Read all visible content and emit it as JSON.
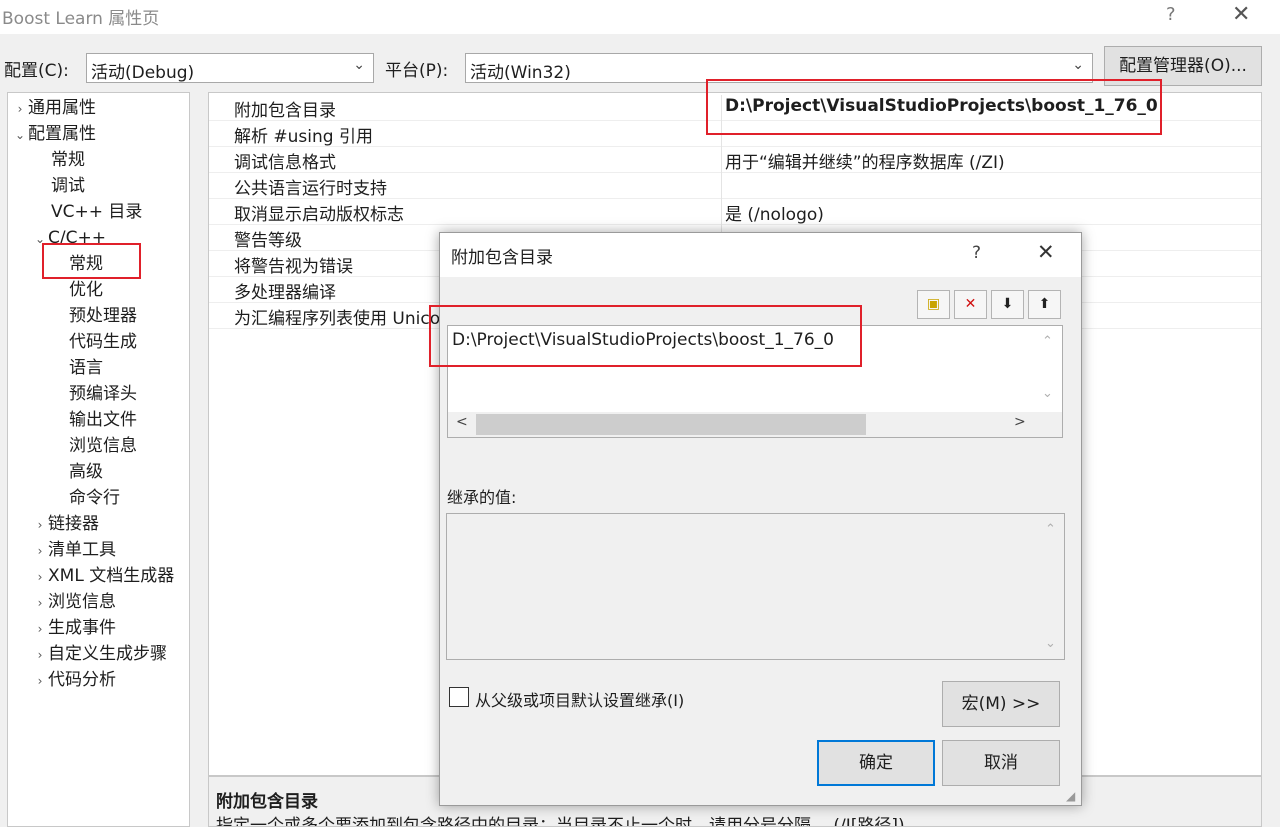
{
  "window": {
    "title": "Boost Learn 属性页",
    "help_glyph": "?",
    "close_glyph": "✕"
  },
  "config_row": {
    "config_label": "配置(C):",
    "config_value": "活动(Debug)",
    "platform_label": "平台(P):",
    "platform_value": "活动(Win32)",
    "manager_button": "配置管理器(O)..."
  },
  "tree": {
    "items": [
      {
        "label": "通用属性",
        "expander": "›"
      },
      {
        "label": "配置属性",
        "expander": "⌄"
      },
      {
        "label": "常规",
        "expander": ""
      },
      {
        "label": "调试",
        "expander": ""
      },
      {
        "label": "VC++ 目录",
        "expander": ""
      },
      {
        "label": "C/C++",
        "expander": "⌄"
      },
      {
        "label": "常规",
        "expander": ""
      },
      {
        "label": "优化",
        "expander": ""
      },
      {
        "label": "预处理器",
        "expander": ""
      },
      {
        "label": "代码生成",
        "expander": ""
      },
      {
        "label": "语言",
        "expander": ""
      },
      {
        "label": "预编译头",
        "expander": ""
      },
      {
        "label": "输出文件",
        "expander": ""
      },
      {
        "label": "浏览信息",
        "expander": ""
      },
      {
        "label": "高级",
        "expander": ""
      },
      {
        "label": "命令行",
        "expander": ""
      },
      {
        "label": "链接器",
        "expander": "›"
      },
      {
        "label": "清单工具",
        "expander": "›"
      },
      {
        "label": "XML 文档生成器",
        "expander": "›"
      },
      {
        "label": "浏览信息",
        "expander": "›"
      },
      {
        "label": "生成事件",
        "expander": "›"
      },
      {
        "label": "自定义生成步骤",
        "expander": "›"
      },
      {
        "label": "代码分析",
        "expander": "›"
      }
    ]
  },
  "grid": {
    "rows": [
      {
        "name": "附加包含目录",
        "value": "D:\\Project\\VisualStudioProjects\\boost_1_76_0"
      },
      {
        "name": "解析 #using 引用",
        "value": ""
      },
      {
        "name": "调试信息格式",
        "value": "用于“编辑并继续”的程序数据库 (/ZI)"
      },
      {
        "name": "公共语言运行时支持",
        "value": ""
      },
      {
        "name": "取消显示启动版权标志",
        "value": "是 (/nologo)"
      },
      {
        "name": "警告等级",
        "value": ""
      },
      {
        "name": "将警告视为错误",
        "value": ""
      },
      {
        "name": "多处理器编译",
        "value": ""
      },
      {
        "name": "为汇编程序列表使用 Unicode",
        "value": ""
      }
    ]
  },
  "description": {
    "title": "附加包含目录",
    "text": "指定一个或多个要添加到包含路径中的目录；当目录不止一个时，请用分号分隔。     (/I[路径])"
  },
  "dialog": {
    "title": "附加包含目录",
    "help_glyph": "?",
    "close_glyph": "✕",
    "toolbar": {
      "new_line_glyph": "▣",
      "delete_glyph": "✕",
      "down_glyph": "⬇",
      "up_glyph": "⬆"
    },
    "entries": [
      "D:\\Project\\VisualStudioProjects\\boost_1_76_0"
    ],
    "inherited_label": "继承的值:",
    "inherit_checkbox_label": "从父级或项目默认设置继承(I)",
    "inherit_checked": false,
    "macros_button": "宏(M) >>",
    "ok_button": "确定",
    "cancel_button": "取消"
  },
  "colors": {
    "highlight_red": "#e0202a",
    "focus_blue": "#0078d7"
  }
}
